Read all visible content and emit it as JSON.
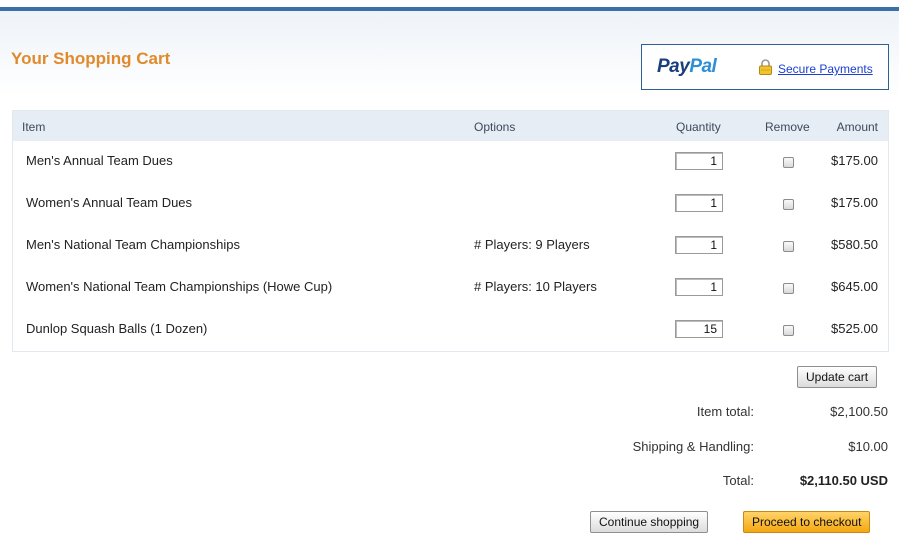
{
  "header": {
    "title": "Your Shopping Cart",
    "paypal_left": "Pay",
    "paypal_right": "Pal",
    "secure_link": "Secure Payments"
  },
  "table": {
    "columns": [
      "Item",
      "Options",
      "Quantity",
      "Remove",
      "Amount"
    ],
    "rows": [
      {
        "item": "Men's Annual Team Dues",
        "options": "",
        "quantity": "1",
        "amount": "$175.00"
      },
      {
        "item": "Women's Annual Team Dues",
        "options": "",
        "quantity": "1",
        "amount": "$175.00"
      },
      {
        "item": "Men's National Team Championships",
        "options": "# Players: 9 Players",
        "quantity": "1",
        "amount": "$580.50"
      },
      {
        "item": "Women's National Team Championships (Howe Cup)",
        "options": "# Players: 10 Players",
        "quantity": "1",
        "amount": "$645.00"
      },
      {
        "item": "Dunlop Squash Balls (1 Dozen)",
        "options": "",
        "quantity": "15",
        "amount": "$525.00"
      }
    ]
  },
  "actions": {
    "update_cart": "Update cart",
    "continue_shopping": "Continue shopping",
    "proceed_checkout": "Proceed to checkout"
  },
  "summary": {
    "item_total_label": "Item total:",
    "item_total_value": "$2,100.50",
    "shipping_label": "Shipping & Handling:",
    "shipping_value": "$10.00",
    "total_label": "Total:",
    "total_value": "$2,110.50 USD"
  },
  "colors": {
    "title": "#e08a2c",
    "top_bar": "#3b6fa6",
    "header_row": "#e6edf5",
    "checkout_button": "#f5a70f"
  },
  "icons": {
    "lock": "lock-icon"
  }
}
